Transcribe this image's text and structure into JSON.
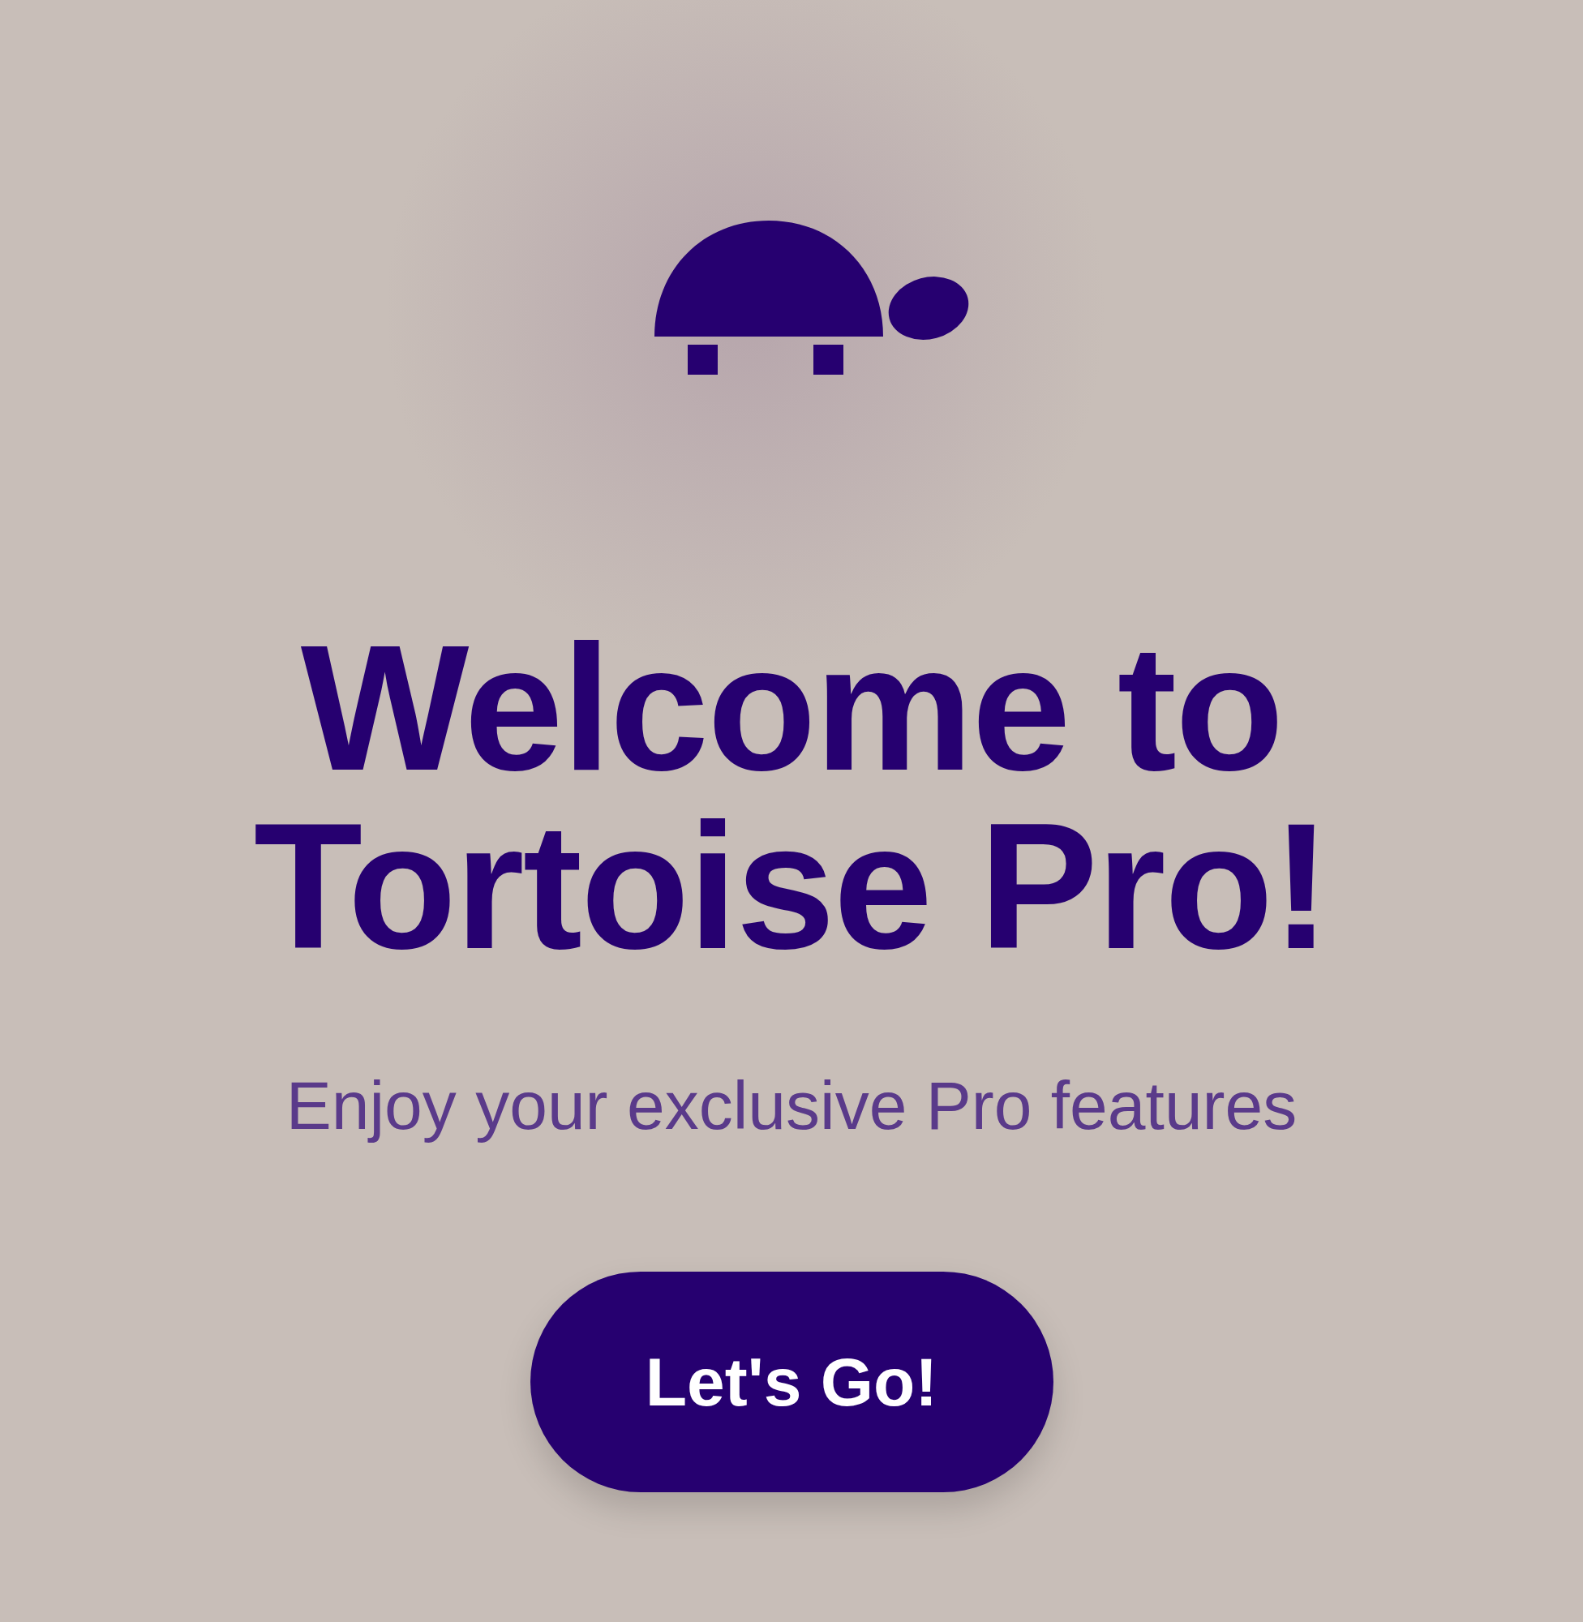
{
  "title": "Welcome to Tortoise Pro!",
  "subtitle": "Enjoy your exclusive Pro features",
  "button": {
    "label": "Let's Go!"
  }
}
